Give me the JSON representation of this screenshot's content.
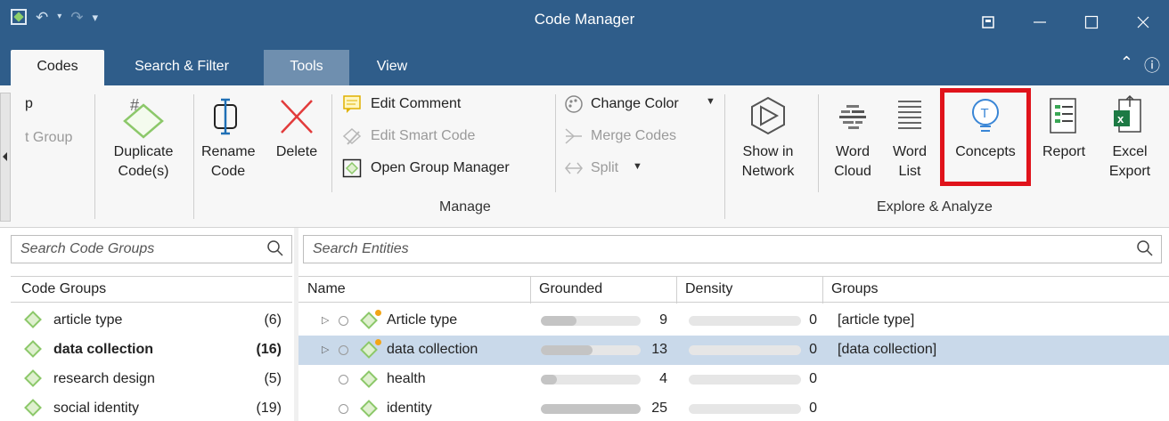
{
  "window": {
    "title": "Code Manager",
    "controls": [
      "restore-mode",
      "minimize",
      "maximize",
      "close"
    ]
  },
  "tabs": [
    {
      "label": "Codes",
      "active": true
    },
    {
      "label": "Search & Filter",
      "active": false
    },
    {
      "label": "Tools",
      "active": false
    },
    {
      "label": "View",
      "active": false
    }
  ],
  "ribbon": {
    "cut_off_1": "p",
    "cut_off_2": "t Group",
    "duplicate": [
      "Duplicate",
      "Code(s)"
    ],
    "rename": [
      "Rename",
      "Code"
    ],
    "delete": "Delete",
    "edit_comment": "Edit Comment",
    "edit_smart_code": "Edit Smart Code",
    "open_group_manager": "Open Group Manager",
    "change_color": "Change Color",
    "merge_codes": "Merge Codes",
    "split": "Split",
    "manage_label": "Manage",
    "show_network": [
      "Show in",
      "Network"
    ],
    "word_cloud": [
      "Word",
      "Cloud"
    ],
    "word_list": [
      "Word",
      "List"
    ],
    "concepts": "Concepts",
    "report": "Report",
    "excel_export": [
      "Excel",
      "Export"
    ],
    "explore_label": "Explore & Analyze",
    "colors": {
      "highlight": "#e0131b",
      "concepts_icon": "#3a86d6"
    }
  },
  "code_groups": {
    "search_placeholder": "Search Code Groups",
    "header": "Code Groups",
    "items": [
      {
        "name": "article type",
        "count": "(6)",
        "bold": false
      },
      {
        "name": "data collection",
        "count": "(16)",
        "bold": true
      },
      {
        "name": "research design",
        "count": "(5)",
        "bold": false
      },
      {
        "name": "social identity",
        "count": "(19)",
        "bold": false
      }
    ]
  },
  "entities": {
    "search_placeholder": "Search Entities",
    "columns": [
      "Name",
      "Grounded",
      "Density",
      "Groups"
    ],
    "rows": [
      {
        "name": "Article type",
        "grounded": "9",
        "grounded_frac": 0.36,
        "density": "0",
        "groups": "[article type]",
        "selected": false,
        "expandable": true,
        "smart": true
      },
      {
        "name": "data collection",
        "grounded": "13",
        "grounded_frac": 0.52,
        "density": "0",
        "groups": "[data collection]",
        "selected": true,
        "expandable": true,
        "smart": true
      },
      {
        "name": "health",
        "grounded": "4",
        "grounded_frac": 0.16,
        "density": "0",
        "groups": "",
        "selected": false,
        "expandable": false,
        "smart": false
      },
      {
        "name": "identity",
        "grounded": "25",
        "grounded_frac": 1.0,
        "density": "0",
        "groups": "",
        "selected": false,
        "expandable": false,
        "smart": false
      }
    ]
  }
}
